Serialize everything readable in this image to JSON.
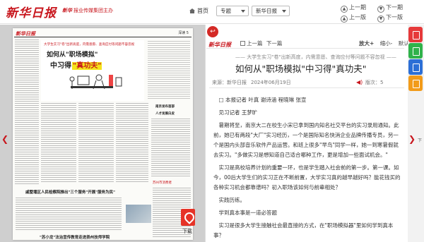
{
  "header": {
    "logo": "新华日报",
    "sublogo_brand": "新华",
    "sublogo_text": "报业传媒集团主办",
    "home_label": "首页",
    "topic_select": "专题",
    "paper_select": "新华日报",
    "prev_issue": "上一期",
    "next_issue": "下一期",
    "prev_page": "上一版",
    "next_page": "下一版"
  },
  "newspaper": {
    "masthead": "新华日报",
    "page_label": "深读 5",
    "deck": "大学生实习\"卷\"出新高度，内需意愿、查询应付等问题不容忽视",
    "headline_line1": "如何从\"职场模拟\"",
    "headline_line2_pre": "中习得",
    "headline_line2_hl": "\"真功夫\"",
    "side_head1": "南京发布首部",
    "side_head2": "人才发展白皮",
    "bottom_head1": "戚墅堰区人民检察院推出\"三个服务\"开展\"服务为民\"",
    "bottom_head2": "\"苏小龙\"法治宣传教育走进扬州技师学院",
    "bottom_head3": "苏州市消费者"
  },
  "download_label": "下载",
  "article_toolbar": {
    "logo": "新华日报",
    "prev_article": "上一篇",
    "next_article": "下一篇",
    "zoom_in": "放大+",
    "zoom_out": "缩小-",
    "default": "默认"
  },
  "article": {
    "kicker": "—— 大学生实习\"卷\"出新高度，内需意愿、查询应付等问题不容忽视 ——",
    "title": "如何从\"职场模拟\"中习得\"真功夫\"",
    "source": "来源：新华日报",
    "date": "2024年06月19日",
    "edition": "版次：5",
    "paragraphs": [
      "□ 本报记者 叶真 谢诗涵 程晓琳 张宣",
      "见习记者 王梦旷",
      "暑期将至，南京大二在校生小宋已拿到国内知名社交平台的实习录用通知。此前，她已有两段\"大厂\"实习经历，一个是国际知名快消企业品牌传播专员，另一个是国内头部音乐软件产品运营。和班上很多\"早鸟\"同学一样，她一到寒暑假就去实习。\"多做实习是想知道自己适合哪种工作，更是增加一些面试机会。\"",
      "实习是高校培养计划的重要一环，也是学生踏入社会前的第一步。第一课。如今，00后大学生们的实习正在不断前置，大学实习真的越早越好吗？能花钱买的各种实习机会都靠谱吗？初入职场该如何与前辈相处？",
      "实践历练。",
      "学到真本事是一道必答题",
      "实习是很多大学生接触社会最直接的方式，在\"职场模拟器\"里如何学到真本事？"
    ]
  },
  "side_tools": [
    "share-red",
    "share-green",
    "share-blue",
    "mobile-orange"
  ],
  "nav_next_label": "下"
}
